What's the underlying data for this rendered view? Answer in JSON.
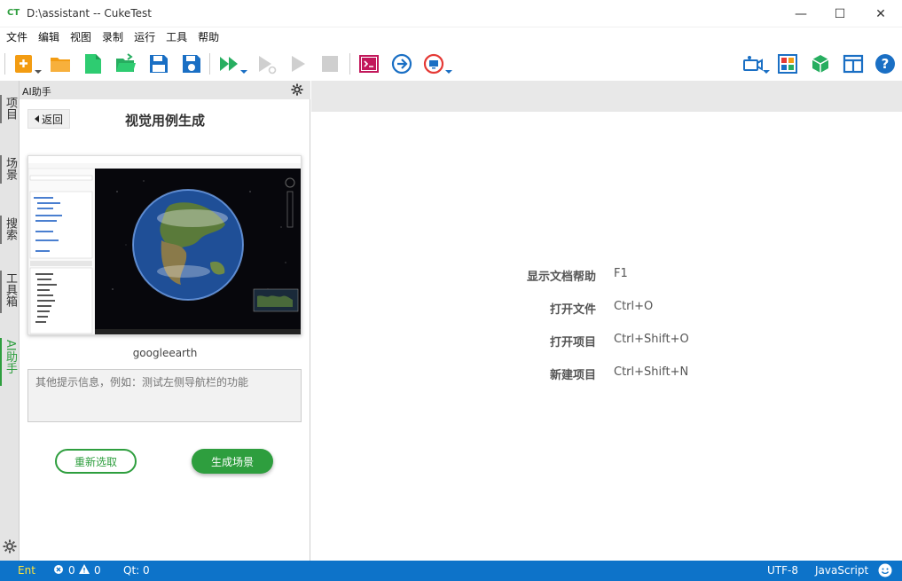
{
  "window": {
    "logo": "CT",
    "title": "D:\\assistant -- CukeTest",
    "minimize": "—",
    "maximize": "☐",
    "close": "✕"
  },
  "menu": [
    "文件",
    "编辑",
    "视图",
    "录制",
    "运行",
    "工具",
    "帮助"
  ],
  "toolbar": {
    "left": [
      "new-icon",
      "open-folder-icon",
      "new-file-icon",
      "open-file-icon",
      "save-icon",
      "save-all-icon",
      "run-all-icon",
      "run-step-icon",
      "play-icon",
      "stop-icon",
      "terminal-icon",
      "navigate-icon",
      "record-screen-icon"
    ],
    "right": [
      "camera-icon",
      "model-icon",
      "package-icon",
      "layout-icon",
      "help-icon"
    ]
  },
  "side_tabs": [
    "项目",
    "场景",
    "搜索",
    "工具箱",
    "AI助手"
  ],
  "ai_panel": {
    "header": "AI助手",
    "back": "返回",
    "title": "视觉用例生成",
    "thumbnail_caption": "googleearth",
    "prompt_placeholder": "其他提示信息，例如：测试左侧导航栏的功能",
    "reselect": "重新选取",
    "generate": "生成场景"
  },
  "shortcuts": [
    {
      "label": "显示文档帮助",
      "key": "F1"
    },
    {
      "label": "打开文件",
      "key": "Ctrl+O"
    },
    {
      "label": "打开项目",
      "key": "Ctrl+Shift+O"
    },
    {
      "label": "新建项目",
      "key": "Ctrl+Shift+N"
    }
  ],
  "status": {
    "ent": "Ent",
    "errors": "0",
    "warnings": "0",
    "qt": "Qt: 0",
    "encoding": "UTF-8",
    "language": "JavaScript"
  },
  "colors": {
    "accent_green": "#2e9e3e",
    "status_blue": "#0d73c9"
  }
}
